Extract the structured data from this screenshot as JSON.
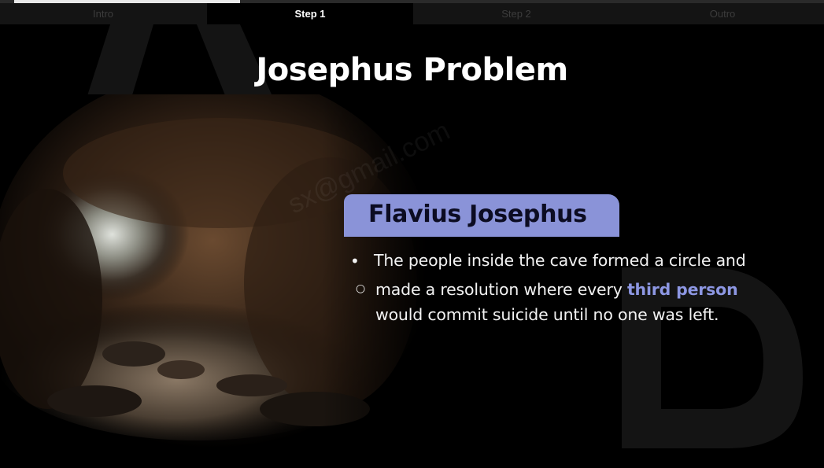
{
  "tabs": [
    {
      "label": "Intro",
      "active": false
    },
    {
      "label": "Step 1",
      "active": true
    },
    {
      "label": "Step 2",
      "active": false
    },
    {
      "label": "Outro",
      "active": false
    }
  ],
  "slide": {
    "title": "Josephus Problem",
    "section_label": "Flavius Josephus",
    "bullet_1": "The people inside the cave formed a circle and",
    "bullet_2_part1": "made a resolution where every ",
    "bullet_2_highlight": "third person",
    "bullet_2_part2": "would commit suicide until no one was left.",
    "watermark": "sx@gmail.com"
  },
  "colors": {
    "accent": "#8a93d8",
    "highlight": "#8d97e3",
    "background": "#000000"
  }
}
